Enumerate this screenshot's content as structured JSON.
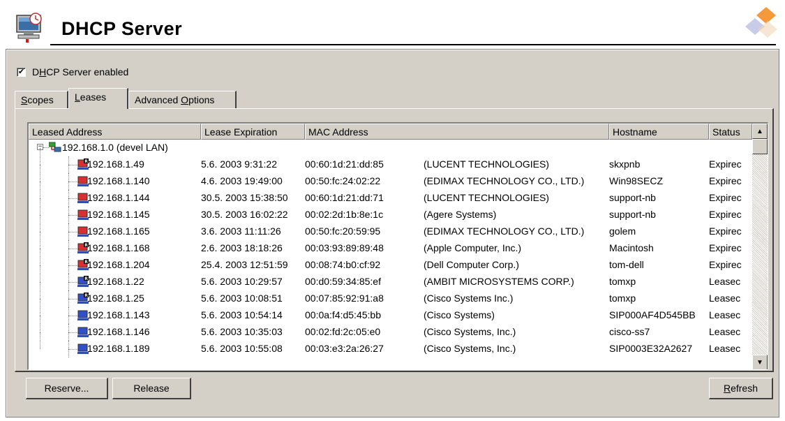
{
  "header": {
    "title": "DHCP Server",
    "icon": "dhcp-server-icon",
    "corner_logo": "diamond-logo-icon"
  },
  "enabled_checkbox": {
    "checked": true,
    "mark": "✔",
    "label_pre": "D",
    "label_accel": "H",
    "label_post": "CP Server enabled"
  },
  "tabs": [
    {
      "accel": "S",
      "rest": "copes",
      "active": false
    },
    {
      "accel": "L",
      "rest": "eases",
      "active": true
    },
    {
      "pre": "Advanced ",
      "accel": "O",
      "rest": "ptions",
      "active": false
    }
  ],
  "columns": [
    "Leased Address",
    "Lease Expiration",
    "MAC Address",
    "",
    "Hostname",
    "Status"
  ],
  "tree_root": {
    "expander": "−",
    "label": "192.168.1.0 (devel LAN)"
  },
  "leases": [
    {
      "ip": "192.168.1.49",
      "expiration": "5.6. 2003 9:31:22",
      "mac": "00:60:1d:21:dd:85",
      "vendor": "(LUCENT TECHNOLOGIES)",
      "hostname": "skxpnb",
      "status": "Expirec",
      "reserved": true
    },
    {
      "ip": "192.168.1.140",
      "expiration": "4.6. 2003 19:49:00",
      "mac": "00:50:fc:24:02:22",
      "vendor": "(EDIMAX TECHNOLOGY CO., LTD.)",
      "hostname": "Win98SECZ",
      "status": "Expirec",
      "reserved": false
    },
    {
      "ip": "192.168.1.144",
      "expiration": "30.5. 2003 15:38:50",
      "mac": "00:60:1d:21:dd:71",
      "vendor": "(LUCENT TECHNOLOGIES)",
      "hostname": "support-nb",
      "status": "Expirec",
      "reserved": false
    },
    {
      "ip": "192.168.1.145",
      "expiration": "30.5. 2003 16:02:22",
      "mac": "00:02:2d:1b:8e:1c",
      "vendor": "(Agere Systems)",
      "hostname": "support-nb",
      "status": "Expirec",
      "reserved": false
    },
    {
      "ip": "192.168.1.165",
      "expiration": "3.6. 2003 11:11:26",
      "mac": "00:50:fc:20:59:95",
      "vendor": "(EDIMAX TECHNOLOGY CO., LTD.)",
      "hostname": "golem",
      "status": "Expirec",
      "reserved": false
    },
    {
      "ip": "192.168.1.168",
      "expiration": "2.6. 2003 18:18:26",
      "mac": "00:03:93:89:89:48",
      "vendor": "(Apple Computer, Inc.)",
      "hostname": "Macintosh",
      "status": "Expirec",
      "reserved": true
    },
    {
      "ip": "192.168.1.204",
      "expiration": "25.4. 2003 12:51:59",
      "mac": "00:08:74:b0:cf:92",
      "vendor": "(Dell Computer Corp.)",
      "hostname": "tom-dell",
      "status": "Expirec",
      "reserved": true
    },
    {
      "ip": "192.168.1.22",
      "expiration": "5.6. 2003 10:29:57",
      "mac": "00:d0:59:34:85:ef",
      "vendor": "(AMBIT MICROSYSTEMS CORP.)",
      "hostname": "tomxp",
      "status": "Leasec",
      "reserved": true
    },
    {
      "ip": "192.168.1.25",
      "expiration": "5.6. 2003 10:08:51",
      "mac": "00:07:85:92:91:a8",
      "vendor": "(Cisco Systems Inc.)",
      "hostname": "tomxp",
      "status": "Leasec",
      "reserved": true
    },
    {
      "ip": "192.168.1.143",
      "expiration": "5.6. 2003 10:54:14",
      "mac": "00:0a:f4:d5:45:bb",
      "vendor": "(Cisco Systems)",
      "hostname": "SIP000AF4D545BB",
      "status": "Leasec",
      "reserved": false
    },
    {
      "ip": "192.168.1.146",
      "expiration": "5.6. 2003 10:35:03",
      "mac": "00:02:fd:2c:05:e0",
      "vendor": "(Cisco Systems, Inc.)",
      "hostname": "cisco-ss7",
      "status": "Leasec",
      "reserved": false
    },
    {
      "ip": "192.168.1.189",
      "expiration": "5.6. 2003 10:55:08",
      "mac": "00:03:e3:2a:26:27",
      "vendor": "(Cisco Systems, Inc.)",
      "hostname": "SIP0003E32A2627",
      "status": "Leasec",
      "reserved": false
    }
  ],
  "scrollbar": {
    "up": "▲",
    "down": "▼"
  },
  "buttons": {
    "reserve": "Reserve...",
    "release": "Release",
    "refresh_accel": "R",
    "refresh_rest": "efresh"
  },
  "colors": {
    "expired_icon": "#d83030",
    "leased_icon": "#3050c8",
    "face": "#d4d0c8"
  }
}
